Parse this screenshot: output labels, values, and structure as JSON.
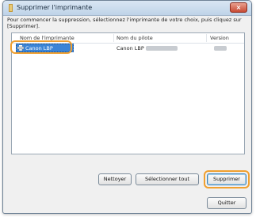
{
  "window": {
    "title": "Supprimer l'imprimante",
    "close_glyph": "×"
  },
  "instructions": "Pour commencer la suppression, sélectionnez l'imprimante de votre choix, puis cliquez sur [Supprimer].",
  "list": {
    "columns": [
      "Nom de l'imprimante",
      "Nom du pilote",
      "Version"
    ],
    "rows": [
      {
        "printer_name": "Canon LBP",
        "driver_prefix": "Canon LBP",
        "driver_redacted": true,
        "version_redacted": true
      }
    ]
  },
  "buttons": {
    "clean": "Nettoyer",
    "select_all": "Sélectionner tout",
    "delete": "Supprimer",
    "quit": "Quitter"
  },
  "colors": {
    "selection": "#3b84d6",
    "highlight": "#f0a030",
    "close": "#c74a34"
  },
  "icons": {
    "app": "printer-settings-icon",
    "row": "printer-icon"
  }
}
